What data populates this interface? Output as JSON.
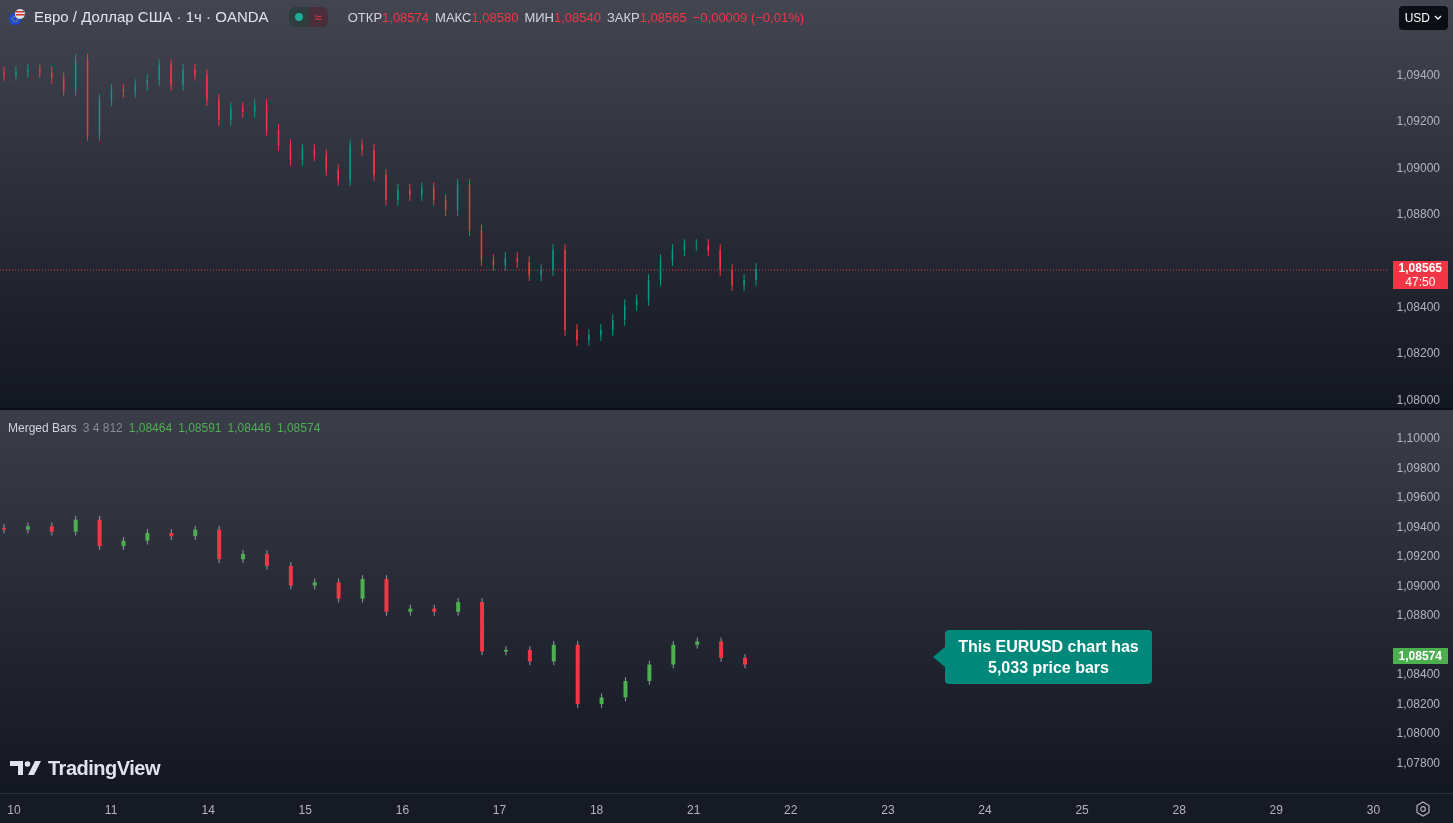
{
  "header": {
    "symbol": "Евро / Доллар США · 1ч · OANDA",
    "status_icon": "≈",
    "ohlc": [
      {
        "label": "ОТКР",
        "value": "1,08574"
      },
      {
        "label": "МАКС",
        "value": "1,08580"
      },
      {
        "label": "МИН",
        "value": "1,08540"
      },
      {
        "label": "ЗАКР",
        "value": "1,08565"
      }
    ],
    "change": "−0,00009 (−0,01%)"
  },
  "currency_button": {
    "label": "USD"
  },
  "main_pane": {
    "price_badge": {
      "price": "1,08565",
      "countdown": "47:50"
    },
    "price_scale": [
      "1,09400",
      "1,09200",
      "1,09000",
      "1,08800",
      "1,08400",
      "1,08200",
      "1,08000"
    ]
  },
  "indicator_pane": {
    "legend": {
      "name": "Merged Bars",
      "params": "3 4 812",
      "values": [
        "1,08464",
        "1,08591",
        "1,08446",
        "1,08574"
      ]
    },
    "price_badge": "1,08574",
    "price_scale": [
      "1,10000",
      "1,09800",
      "1,09600",
      "1,09400",
      "1,09200",
      "1,09000",
      "1,08800",
      "1,08400",
      "1,08200",
      "1,08000",
      "1,07800"
    ]
  },
  "callout": "This EURUSD chart has 5,033 price bars",
  "logo": "TradingView",
  "time_axis": [
    "10",
    "11",
    "14",
    "15",
    "16",
    "17",
    "18",
    "21",
    "22",
    "23",
    "24",
    "25",
    "28",
    "29",
    "30"
  ]
}
